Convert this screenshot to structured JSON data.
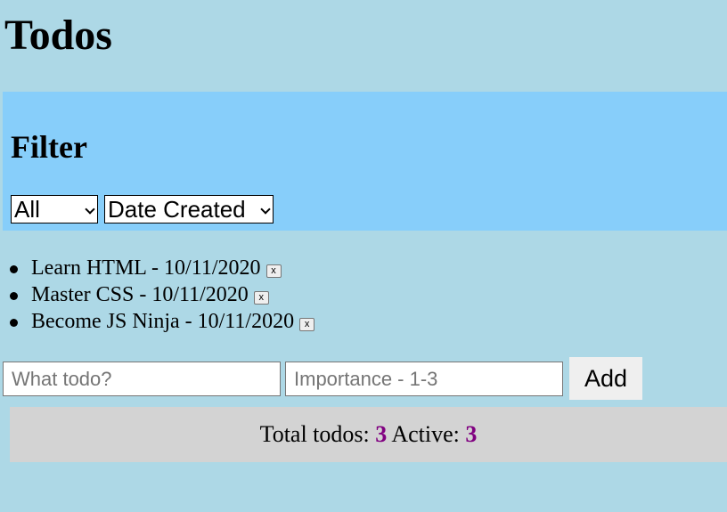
{
  "app": {
    "title": "Todos"
  },
  "filter": {
    "heading": "Filter",
    "status_select": {
      "selected": "All"
    },
    "sort_select": {
      "selected": "Date Created"
    }
  },
  "todos": [
    {
      "text": "Learn HTML - 10/11/2020",
      "delete_label": "x"
    },
    {
      "text": "Master CSS - 10/11/2020",
      "delete_label": "x"
    },
    {
      "text": "Become JS Ninja - 10/11/2020",
      "delete_label": "x"
    }
  ],
  "form": {
    "todo_placeholder": "What todo?",
    "importance_placeholder": "Importance - 1-3",
    "add_label": "Add"
  },
  "footer": {
    "total_label": "Total todos:",
    "total_count": "3",
    "active_label": "Active:",
    "active_count": "3"
  },
  "colors": {
    "background": "#add8e6",
    "filter_panel": "#87cefa",
    "footer": "#d3d3d3",
    "count": "#800080"
  }
}
